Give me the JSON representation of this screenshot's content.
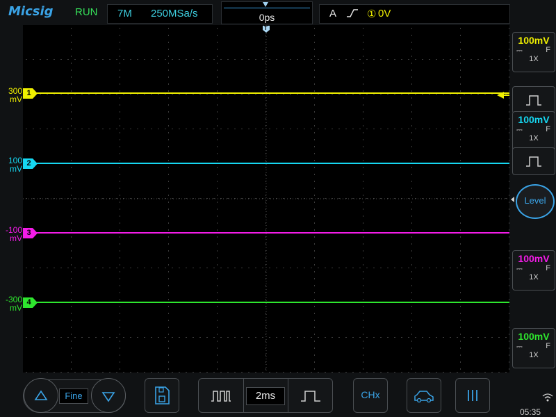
{
  "topbar": {
    "logo": "Micsig",
    "run_state": "RUN",
    "memory_depth": "7M",
    "sample_rate": "250MSa/s",
    "time_offset": "0ps",
    "trigger_mode": "A",
    "trigger_edge_icon": "rising-edge-icon",
    "trigger_source": "①",
    "trigger_level": "0V"
  },
  "channels": [
    {
      "id": "1",
      "color": "#f0f000",
      "offset_label": "300",
      "offset_unit": "mV",
      "volts_div": "100mV",
      "coupling": "⎓",
      "bandwidth": "F",
      "probe": "1X"
    },
    {
      "id": "2",
      "color": "#16d8f2",
      "offset_label": "100",
      "offset_unit": "mV",
      "volts_div": "100mV",
      "coupling": "⎓",
      "bandwidth": "F",
      "probe": "1X"
    },
    {
      "id": "3",
      "color": "#f41ce8",
      "offset_label": "-100",
      "offset_unit": "mV",
      "volts_div": "100mV",
      "coupling": "⎓",
      "bandwidth": "F",
      "probe": "1X"
    },
    {
      "id": "4",
      "color": "#2ee62e",
      "offset_label": "-300",
      "offset_unit": "mV",
      "volts_div": "100mV",
      "coupling": "⎓",
      "bandwidth": "F",
      "probe": "1X"
    }
  ],
  "right_panel": {
    "level_button": "Level"
  },
  "bottombar": {
    "fine_label": "Fine",
    "timebase": "2ms",
    "chx_label": "CHx",
    "clock": "05:35"
  },
  "colors": {
    "accent": "#3aa3e6",
    "run": "#36e05a",
    "plot_background": "#000000"
  }
}
